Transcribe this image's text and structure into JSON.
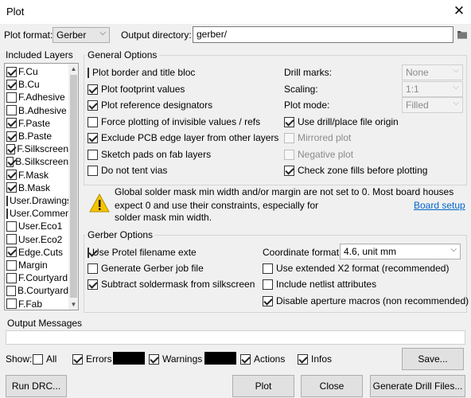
{
  "window": {
    "title": "Plot",
    "close_glyph": "✕"
  },
  "top": {
    "plot_format_label": "Plot format:",
    "plot_format_value": "Gerber",
    "output_dir_label": "Output directory:",
    "output_dir_value": "gerber/"
  },
  "layers": {
    "header": "Included Layers",
    "items": [
      {
        "label": "F.Cu",
        "checked": true
      },
      {
        "label": "B.Cu",
        "checked": true
      },
      {
        "label": "F.Adhesive",
        "checked": false
      },
      {
        "label": "B.Adhesive",
        "checked": false
      },
      {
        "label": "F.Paste",
        "checked": true
      },
      {
        "label": "B.Paste",
        "checked": true
      },
      {
        "label": "F.Silkscreen",
        "checked": true
      },
      {
        "label": "B.Silkscreen",
        "checked": true
      },
      {
        "label": "F.Mask",
        "checked": true
      },
      {
        "label": "B.Mask",
        "checked": true
      },
      {
        "label": "User.Drawings",
        "checked": false
      },
      {
        "label": "User.Comments",
        "checked": false
      },
      {
        "label": "User.Eco1",
        "checked": false
      },
      {
        "label": "User.Eco2",
        "checked": false
      },
      {
        "label": "Edge.Cuts",
        "checked": true
      },
      {
        "label": "Margin",
        "checked": false
      },
      {
        "label": "F.Courtyard",
        "checked": false
      },
      {
        "label": "B.Courtyard",
        "checked": false
      },
      {
        "label": "F.Fab",
        "checked": false
      }
    ]
  },
  "general": {
    "title": "General Options",
    "options": [
      {
        "label": "Plot border and title block",
        "checked": false
      },
      {
        "label": "Plot footprint values",
        "checked": true
      },
      {
        "label": "Plot reference designators",
        "checked": true
      },
      {
        "label": "Force plotting of invisible values / refs",
        "checked": false
      },
      {
        "label": "Exclude PCB edge layer from other layers",
        "checked": true
      },
      {
        "label": "Sketch pads on fab layers",
        "checked": false
      },
      {
        "label": "Do not tent vias",
        "checked": false
      }
    ],
    "drill_marks_label": "Drill marks:",
    "drill_marks_value": "None",
    "scaling_label": "Scaling:",
    "scaling_value": "1:1",
    "plot_mode_label": "Plot mode:",
    "plot_mode_value": "Filled",
    "right_options": [
      {
        "label": "Use drill/place file origin",
        "checked": true,
        "disabled": false
      },
      {
        "label": "Mirrored plot",
        "checked": false,
        "disabled": true
      },
      {
        "label": "Negative plot",
        "checked": false,
        "disabled": true
      },
      {
        "label": "Check zone fills before plotting",
        "checked": true,
        "disabled": false
      }
    ]
  },
  "warning": {
    "icon": "warning-icon",
    "line1": "Global solder mask min width and/or margin are not set to 0.  Most board houses",
    "line2": "expect 0 and use their constraints, especially for",
    "line3": "solder mask min width.",
    "link": "Board setup"
  },
  "gerber": {
    "title": "Gerber Options",
    "options": [
      {
        "label": "Use Protel filename extensions",
        "checked": true
      },
      {
        "label": "Generate Gerber job file",
        "checked": false
      },
      {
        "label": "Subtract soldermask from silkscreen",
        "checked": true
      }
    ],
    "coord_label": "Coordinate format:",
    "coord_value": "4.6, unit mm",
    "right_options": [
      {
        "label": "Use extended X2 format (recommended)",
        "checked": false
      },
      {
        "label": "Include netlist attributes",
        "checked": false
      },
      {
        "label": "Disable aperture macros (non recommended)",
        "checked": true
      }
    ]
  },
  "messages": {
    "title": "Output Messages",
    "show_label": "Show:",
    "filters": [
      {
        "label": "All",
        "checked": false
      },
      {
        "label": "Errors",
        "checked": true
      },
      {
        "label": "Warnings",
        "checked": true
      },
      {
        "label": "Actions",
        "checked": true
      },
      {
        "label": "Infos",
        "checked": true
      }
    ],
    "save_button": "Save..."
  },
  "buttons": {
    "run_drc": "Run DRC...",
    "plot": "Plot",
    "close": "Close",
    "drill": "Generate Drill Files..."
  }
}
